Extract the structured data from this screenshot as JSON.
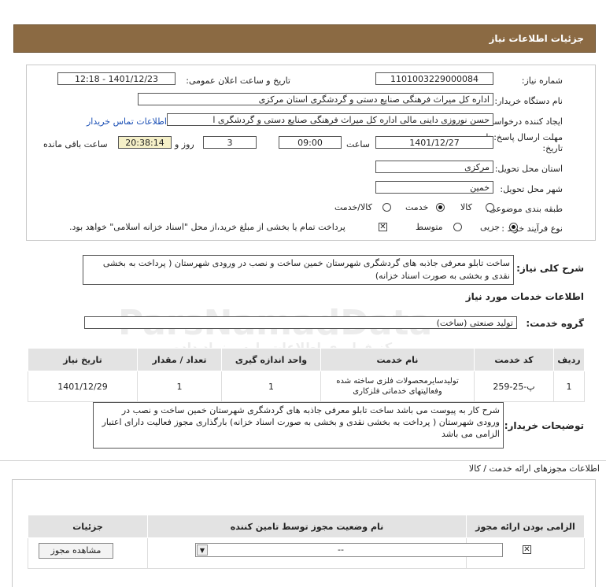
{
  "header": {
    "title": "جزئیات اطلاعات نیاز"
  },
  "fields": {
    "need_number_label": "شماره نیاز:",
    "need_number": "1101003229000084",
    "announce_label": "تاریخ و ساعت اعلان عمومی:",
    "announce_value": "1401/12/23 - 12:18",
    "buyer_label": "نام دستگاه خریدار:",
    "buyer_value": "اداره کل میراث فرهنگی  صنایع دستی و گردشگری استان مرکزی",
    "creator_label": "ایجاد کننده درخواست:",
    "creator_value": "حسن نوروزی داینی مالی  اداره کل میراث فرهنگی  صنایع دستی و گردشگری ا",
    "contact_link": "اطلاعات تماس خریدار",
    "deadline_label_1": "مهلت ارسال پاسخ: تا",
    "deadline_label_2": "تاریخ:",
    "deadline_date": "1401/12/27",
    "time_label": "ساعت",
    "deadline_time": "09:00",
    "days_value": "3",
    "days_label": "روز و",
    "remaining_time": "20:38:14",
    "remaining_label": "ساعت باقی مانده",
    "province_label": "استان محل تحویل:",
    "province_value": "مرکزی",
    "city_label": "شهر محل تحویل:",
    "city_value": "خمین",
    "category_label": "طبقه بندی موضوعی:",
    "category_options": [
      "کالا",
      "خدمت",
      "کالا/خدمت"
    ],
    "category_selected": "خدمت",
    "process_label": "نوع فرآیند خرید :",
    "process_options": [
      "جزیی",
      "متوسط"
    ],
    "process_selected": "جزیی",
    "process_note": "پرداخت تمام یا بخشی از مبلغ خرید،از محل \"اسناد خزانه اسلامی\" خواهد بود."
  },
  "summary": {
    "label": "شرح کلی نیاز:",
    "text": "ساخت تابلو معرفی جاذبه های گردشگری شهرستان خمین  ساخت و نصب در ورودی شهرستان  ( پرداخت به بخشی نقدی و بخشی به صورت اسناد خزانه)"
  },
  "services": {
    "section_title": "اطلاعات خدمات مورد نیاز",
    "group_label": "گروه خدمت:",
    "group_value": "تولید صنعتی (ساخت)",
    "columns": [
      "ردیف",
      "کد خدمت",
      "نام خدمت",
      "واحد اندازه گیری",
      "تعداد / مقدار",
      "تاریخ نیاز"
    ],
    "rows": [
      [
        "1",
        "پ-25-259",
        "تولیدسایرمحصولات فلزی ساخته شده وفعالیتهای خدماتی فلزکاری",
        "1",
        "1",
        "1401/12/29"
      ]
    ]
  },
  "buyer_notes": {
    "label": "توضیحات خریدار:",
    "text": "شرح کار به پیوست می باشد ساخت تابلو معرفی جاذبه های گردشگری شهرستان خمین  ساخت و نصب در ورودی شهرستان  ( پرداخت به بخشی نقدی و بخشی به صورت اسناد خزانه) بارگذاری مجوز فعالیت دارای اعتبار الزامی می باشد"
  },
  "permits": {
    "section_title": "اطلاعات مجوزهای ارائه خدمت / کالا",
    "columns": [
      "الزامی بودن ارائه مجوز",
      "نام وضعیت مجوز توسط تامین کننده",
      "جزئیات"
    ],
    "select_value": "--",
    "view_button": "مشاهده مجوز"
  },
  "watermark": {
    "line1": "0101",
    "line2": "ParsNamadData",
    "line3": "مرکز فراوری اطلاعات پارس نماد داده",
    "line4": "پایگاه اطلاع رسانی مناقصه و مزایده"
  },
  "colors": {
    "header_bg": "#8b6a43",
    "link": "#1a4fb5",
    "yellow_box": "#f5f0c8"
  }
}
